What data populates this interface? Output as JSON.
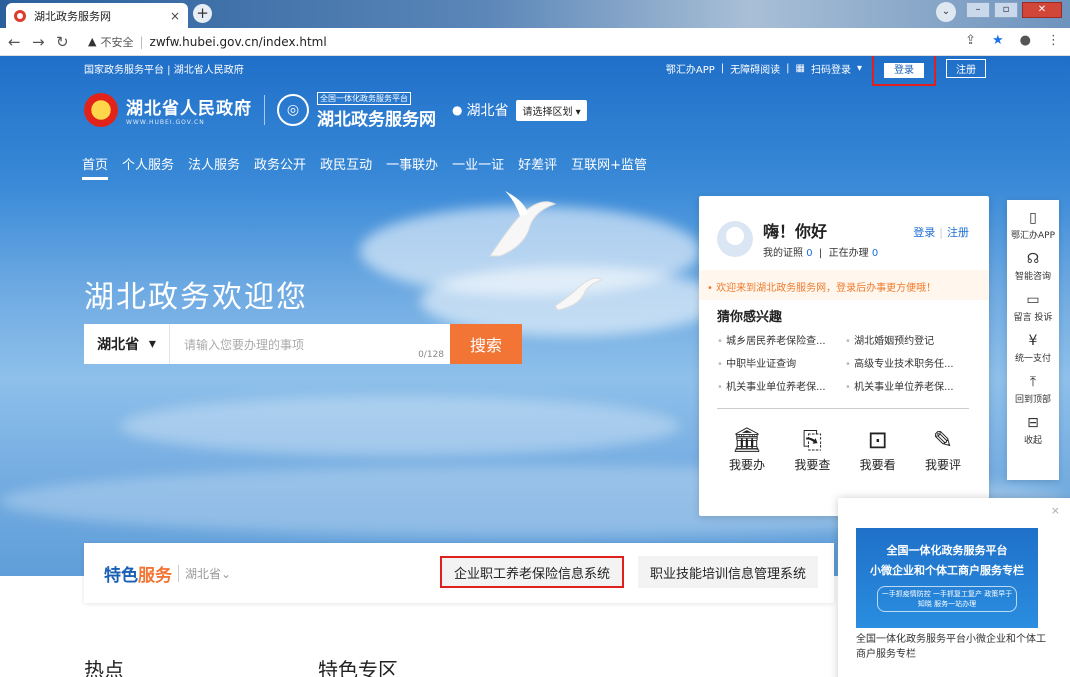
{
  "browser": {
    "tab_title": "湖北政务服务网",
    "tab_close": "×",
    "new_tab": "+",
    "insecure_label": "不安全",
    "url": "zwfw.hubei.gov.cn/index.html"
  },
  "topbar": {
    "left_links": "国家政务服务平台 | 湖北省人民政府",
    "app": "鄂汇办APP",
    "accessible": "无障碍阅读",
    "scan": "扫码登录",
    "login": "登录",
    "register": "注册"
  },
  "header": {
    "gov_name": "湖北省人民政府",
    "gov_url": "WWW.HUBEI.GOV.CN",
    "svc_tag": "全国一体化政务服务平台",
    "svc_name": "湖北政务服务网",
    "location": "湖北省",
    "region_select": "请选择区划"
  },
  "nav": [
    "首页",
    "个人服务",
    "法人服务",
    "政务公开",
    "政民互动",
    "一事联办",
    "一业一证",
    "好差评",
    "互联网+监管"
  ],
  "hero": {
    "welcome": "湖北政务欢迎您",
    "search_province": "湖北省",
    "search_placeholder": "请输入您要办理的事项",
    "search_count": "0/128",
    "search_button": "搜索"
  },
  "panel": {
    "greeting": "嗨！你好",
    "my_license": "我的证照",
    "license_count": "0",
    "in_progress": "正在办理",
    "progress_count": "0",
    "login": "登录",
    "register": "注册",
    "notice": "• 欢迎来到湖北政务服务网，登录后办事更方便哦！",
    "guess_title": "猜你感兴趣",
    "guess_items": [
      "城乡居民养老保险查...",
      "湖北婚姻预约登记",
      "中职毕业证查询",
      "高级专业技术职务任...",
      "机关事业单位养老保...",
      "机关事业单位养老保..."
    ],
    "quick": [
      {
        "label": "我要办",
        "icon": "🏛"
      },
      {
        "label": "我要查",
        "icon": "⎘"
      },
      {
        "label": "我要看",
        "icon": "⊡"
      },
      {
        "label": "我要评",
        "icon": "✎"
      }
    ]
  },
  "sidebar": [
    {
      "label": "鄂汇办APP",
      "icon": "▯"
    },
    {
      "label": "智能咨询",
      "icon": "☊"
    },
    {
      "label": "留言 投诉",
      "icon": "▭"
    },
    {
      "label": "统一支付",
      "icon": "¥"
    },
    {
      "label": "回到顶部",
      "icon": "⤒"
    },
    {
      "label": "收起",
      "icon": "⊟"
    }
  ],
  "featured": {
    "title_a": "特色",
    "title_b": "服务",
    "province": "湖北省⌄",
    "chips": [
      "企业职工养老保险信息系统",
      "职业技能培训信息管理系统"
    ]
  },
  "sections": [
    "热点",
    "特色专区"
  ],
  "promo": {
    "close": "×",
    "line1": "全国一体化政务服务平台",
    "line2": "小微企业和个体工商户服务专栏",
    "line3": "一手抓疫情防控 一手抓复工复产 政策早于知晓 服务一站办理",
    "desc": "全国一体化政务服务平台小微企业和个体工商户服务专栏"
  }
}
